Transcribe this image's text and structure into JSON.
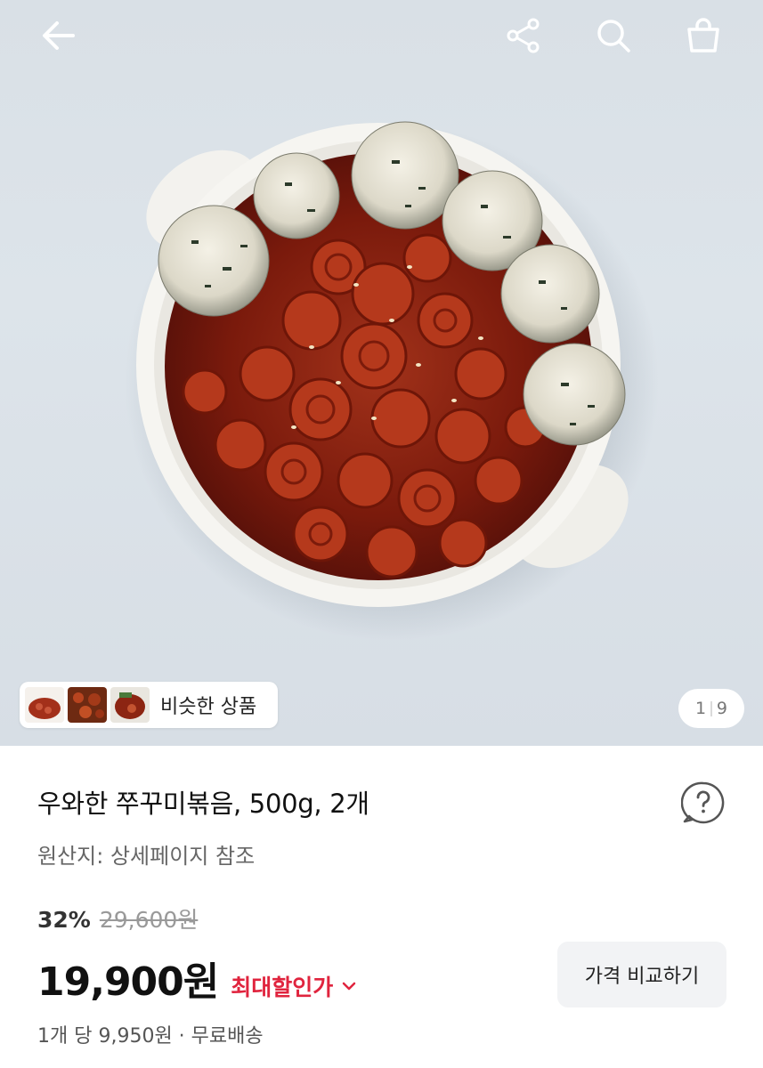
{
  "header": {
    "back_icon": "arrow-left-icon",
    "share_icon": "share-icon",
    "search_icon": "search-icon",
    "cart_icon": "shopping-bag-icon"
  },
  "gallery": {
    "similar_label": "비슷한 상품",
    "page_current": "1",
    "page_total": "9"
  },
  "product": {
    "title": "우와한 쭈꾸미볶음, 500g, 2개",
    "origin": "원산지: 상세페이지 참조",
    "discount_rate": "32%",
    "original_price": "29,600원",
    "price": "19,900원",
    "max_discount_label": "최대할인가",
    "compare_label": "가격 비교하기",
    "per_unit": "1개 당 9,950원 · 무료배송"
  },
  "colors": {
    "accent_red": "#e0243e",
    "background_hero": "#dbe2e8",
    "compare_bg": "#f2f3f5"
  }
}
